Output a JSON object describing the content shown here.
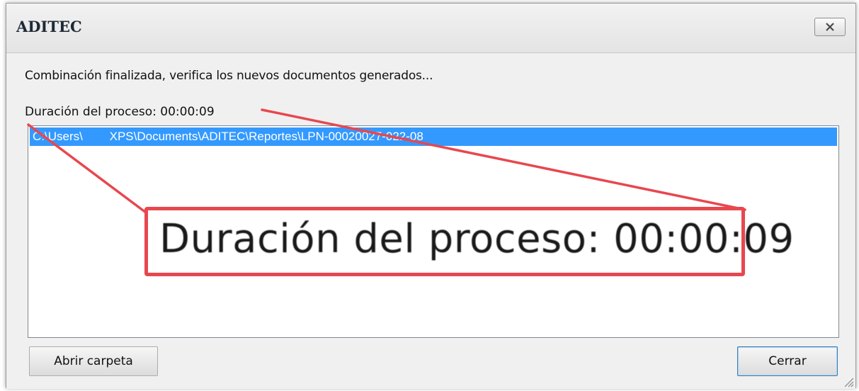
{
  "window": {
    "title": "ADITEC"
  },
  "icons": {
    "close": "close-x-icon",
    "grip": "resize-grip-icon"
  },
  "message": "Combinación finalizada, verifica los nuevos documentos generados...",
  "duration_text": "Duración del proceso: 00:00:09",
  "list": {
    "items": [
      "C:\\Users\\        XPS\\Documents\\ADITEC\\Reportes\\LPN-00020027-022-08"
    ]
  },
  "buttons": {
    "open_folder": "Abrir carpeta",
    "close": "Cerrar"
  },
  "annotation": {
    "zoom_text": "Duración del proceso: 00:00:09",
    "color": "#e8474f"
  },
  "colors": {
    "selection": "#3399ff",
    "dialog_bg": "#f0f0f0"
  }
}
